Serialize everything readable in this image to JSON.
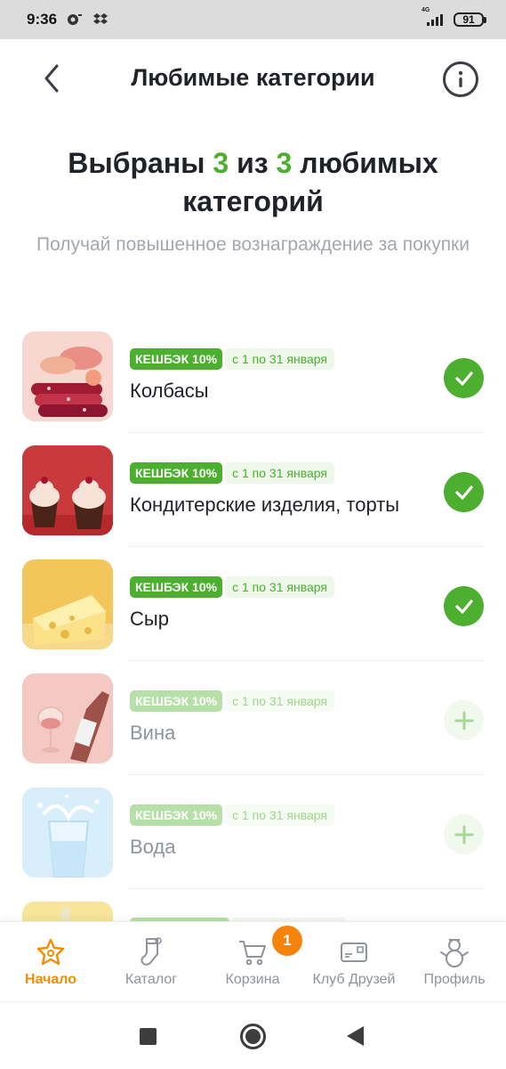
{
  "status_bar": {
    "time": "9:36",
    "network": "4G",
    "battery": "91"
  },
  "header": {
    "title": "Любимые категории",
    "back_icon": "chevron-left-icon",
    "info_icon": "info-icon"
  },
  "heading": {
    "part1": "Выбраны ",
    "selected": "3",
    "part2": " из ",
    "total": "3",
    "part3": " любимых категорий"
  },
  "subheading": "Получай повышенное вознаграждение за покупки",
  "categories": [
    {
      "badge": "КЕШБЭК 10%",
      "period": "с 1 по 31 января",
      "name": "Колбасы",
      "selected": true,
      "image": "sausages"
    },
    {
      "badge": "КЕШБЭК 10%",
      "period": "с 1 по 31 января",
      "name": "Кондитерские изделия, торты",
      "selected": true,
      "image": "cupcakes"
    },
    {
      "badge": "КЕШБЭК 10%",
      "period": "с 1 по 31 января",
      "name": "Сыр",
      "selected": true,
      "image": "cheese"
    },
    {
      "badge": "КЕШБЭК 10%",
      "period": "с 1 по 31 января",
      "name": "Вина",
      "selected": false,
      "image": "wine"
    },
    {
      "badge": "КЕШБЭК 10%",
      "period": "с 1 по 31 января",
      "name": "Вода",
      "selected": false,
      "image": "water"
    }
  ],
  "bottom_nav": [
    {
      "label": "Начало",
      "icon": "star-home-icon",
      "active": true
    },
    {
      "label": "Каталог",
      "icon": "stocking-icon",
      "active": false
    },
    {
      "label": "Корзина",
      "icon": "cart-icon",
      "active": false,
      "badge": "1"
    },
    {
      "label": "Клуб Друзей",
      "icon": "card-icon",
      "active": false
    },
    {
      "label": "Профиль",
      "icon": "snowman-icon",
      "active": false
    }
  ],
  "colors": {
    "accent_green": "#4caf2f",
    "accent_orange": "#f28c00",
    "text_dark": "#1f2227",
    "text_muted": "#a3a8ae"
  }
}
